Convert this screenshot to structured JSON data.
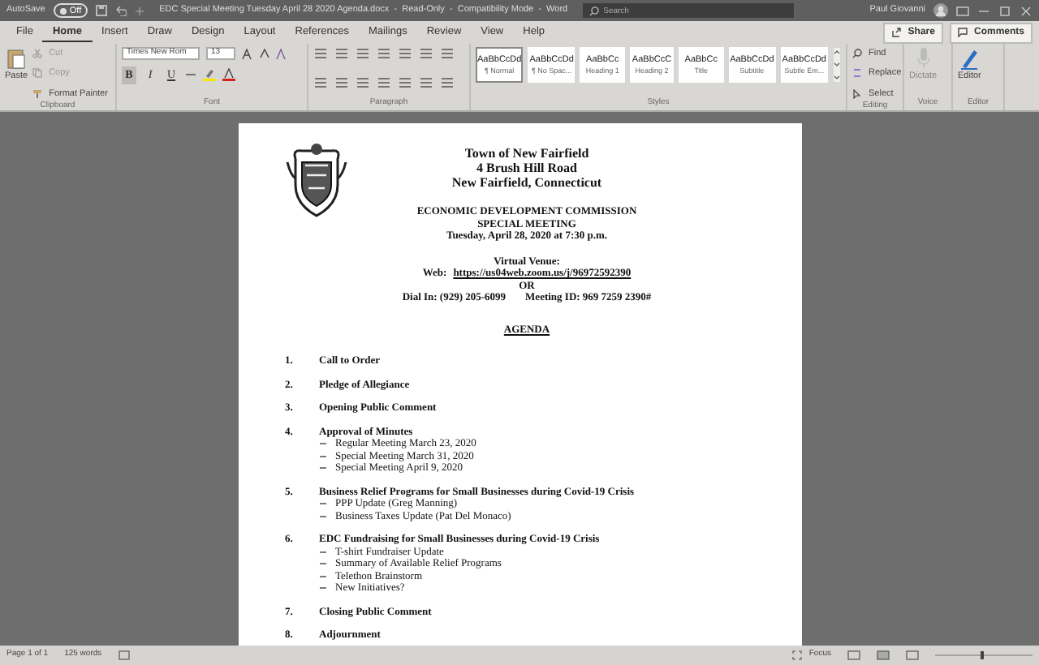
{
  "title_bar": {
    "autosave_label": "AutoSave",
    "autosave": {
      "on": false,
      "label": "Off"
    },
    "title": "EDC Special Meeting Tuesday April 28 2020 Agenda.docx  -  Read-Only  -  Compatibility Mode  -  Word",
    "search": {
      "placeholder": "Search"
    },
    "user": "Paul Giovanni"
  },
  "tabs": [
    {
      "label": "File",
      "selected": false
    },
    {
      "label": "Home",
      "selected": true
    },
    {
      "label": "Insert",
      "selected": false
    },
    {
      "label": "Draw",
      "selected": false
    },
    {
      "label": "Design",
      "selected": false
    },
    {
      "label": "Layout",
      "selected": false
    },
    {
      "label": "References",
      "selected": false
    },
    {
      "label": "Mailings",
      "selected": false
    },
    {
      "label": "Review",
      "selected": false
    },
    {
      "label": "View",
      "selected": false
    },
    {
      "label": "Help",
      "selected": false
    }
  ],
  "share": "Share",
  "comments": "Comments",
  "ribbon": {
    "clipboard": {
      "paste": "Paste",
      "cut": "Cut",
      "copy": "Copy",
      "format_painter": "Format Painter",
      "label": "Clipboard"
    },
    "font": {
      "font_name": "Times New Rom",
      "size": "13",
      "format_buttons": [
        "B",
        "I",
        "U"
      ],
      "label": "Font"
    },
    "paragraph": {
      "label": "Paragraph"
    },
    "styles": {
      "items": [
        {
          "preview": "AaBbCcDd",
          "name": "¶ Normal",
          "selected": true
        },
        {
          "preview": "AaBbCcDd",
          "name": "¶ No Spac...",
          "selected": false
        },
        {
          "preview": "AaBbCc",
          "name": "Heading 1",
          "selected": false
        },
        {
          "preview": "AaBbCcC",
          "name": "Heading 2",
          "selected": false
        },
        {
          "preview": "AaBbCc",
          "name": "Title",
          "selected": false
        },
        {
          "preview": "AaBbCcDd",
          "name": "Subtitle",
          "selected": false
        },
        {
          "preview": "AaBbCcDd",
          "name": "Subtle Em...",
          "selected": false
        }
      ],
      "label": "Styles"
    },
    "editing": {
      "find": "Find",
      "replace": "Replace",
      "select": "Select",
      "label": "Editing"
    },
    "voice": {
      "dictate": "Dictate",
      "label": "Voice"
    },
    "editor": {
      "button": "Editor",
      "label": "Editor"
    }
  },
  "document": {
    "header": [
      "Town of New Fairfield",
      "4 Brush Hill Road",
      "New Fairfield, Connecticut"
    ],
    "meeting": [
      "ECONOMIC DEVELOPMENT COMMISSION",
      "SPECIAL MEETING",
      "Tuesday, April 28, 2020 at 7:30 p.m."
    ],
    "venue_heading": "Virtual Venue:",
    "web_label": "Web:",
    "web_link": "https://us04web.zoom.us/j/96972592390",
    "or": "OR",
    "dial_in": "Dial In: (929) 205-6099",
    "meeting_id": "Meeting ID: 969 7259 2390#",
    "agenda_title": "AGENDA",
    "agenda": [
      {
        "number": "1.",
        "title": "Call to Order"
      },
      {
        "number": "2.",
        "title": "Pledge of Allegiance"
      },
      {
        "number": "3.",
        "title": "Opening Public Comment"
      },
      {
        "number": "4.",
        "title": "Approval of Minutes",
        "children": [
          "Regular Meeting March 23, 2020",
          "Special Meeting March 31, 2020",
          "Special Meeting April 9, 2020"
        ]
      },
      {
        "number": "5.",
        "title": "Business Relief Programs for Small Businesses during Covid-19 Crisis",
        "children": [
          "PPP Update (Greg Manning)",
          "Business Taxes Update (Pat Del Monaco)"
        ]
      },
      {
        "number": "6.",
        "title": "EDC Fundraising for Small Businesses during Covid-19 Crisis",
        "children": [
          "T-shirt Fundraiser Update",
          "Summary of Available Relief Programs",
          "Telethon Brainstorm",
          "New Initiatives?"
        ]
      },
      {
        "number": "7.",
        "title": "Closing Public Comment"
      },
      {
        "number": "8.",
        "title": "Adjournment"
      }
    ]
  },
  "status_bar": {
    "page": "Page 1 of 1",
    "words": "125 words",
    "focus": "Focus"
  }
}
